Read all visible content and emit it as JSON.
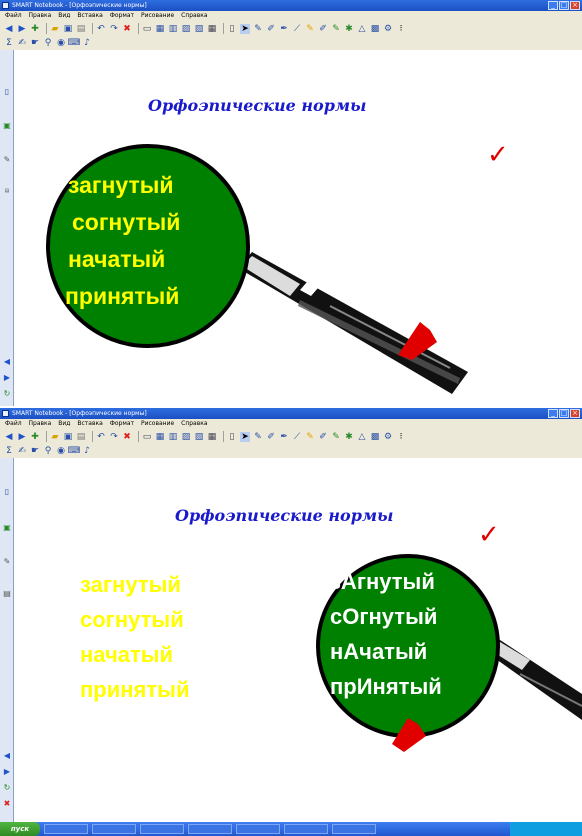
{
  "screen1": {
    "window_title": "SMART Notebook - [Орфоэпические нормы]",
    "menu": [
      "Файл",
      "Правка",
      "Вид",
      "Вставка",
      "Формат",
      "Рисование",
      "Справка"
    ],
    "slide_title": "Орфоэпические нормы",
    "check_mark": "✓",
    "words": [
      "загнутый",
      "согнутый",
      "начатый",
      "принятый"
    ]
  },
  "screen2": {
    "window_title": "SMART Notebook - [Орфоэпические нормы]",
    "menu": [
      "Файл",
      "Правка",
      "Вид",
      "Вставка",
      "Формат",
      "Рисование",
      "Справка"
    ],
    "slide_title": "Орфоэпические нормы",
    "check_mark": "✓",
    "words_plain": [
      "загнутый",
      "согнутый",
      "начатый",
      "принятый"
    ],
    "words_stressed": [
      "зАгнутый",
      "сОгнутый",
      "нАчатый",
      "прИнятый"
    ]
  },
  "taskbar": {
    "start_label": "пуск",
    "tasks": [
      "",
      "",
      "",
      "",
      "",
      "",
      ""
    ]
  },
  "colors": {
    "title_blue": "#1a1acc",
    "lens_green": "#008000",
    "word_yellow": "#ffff00",
    "arrow_red": "#e00000"
  },
  "icons": {
    "window_close": "close-icon",
    "toolbar": [
      "back-arrow-icon",
      "forward-arrow-icon",
      "open-icon",
      "save-icon",
      "paste-icon",
      "undo-icon",
      "redo-icon",
      "delete-icon",
      "screen-shade-icon",
      "table-icon",
      "select-icon",
      "pen-icon",
      "highlighter-icon",
      "eraser-icon",
      "line-icon",
      "shapes-icon",
      "fill-icon",
      "text-icon"
    ]
  }
}
